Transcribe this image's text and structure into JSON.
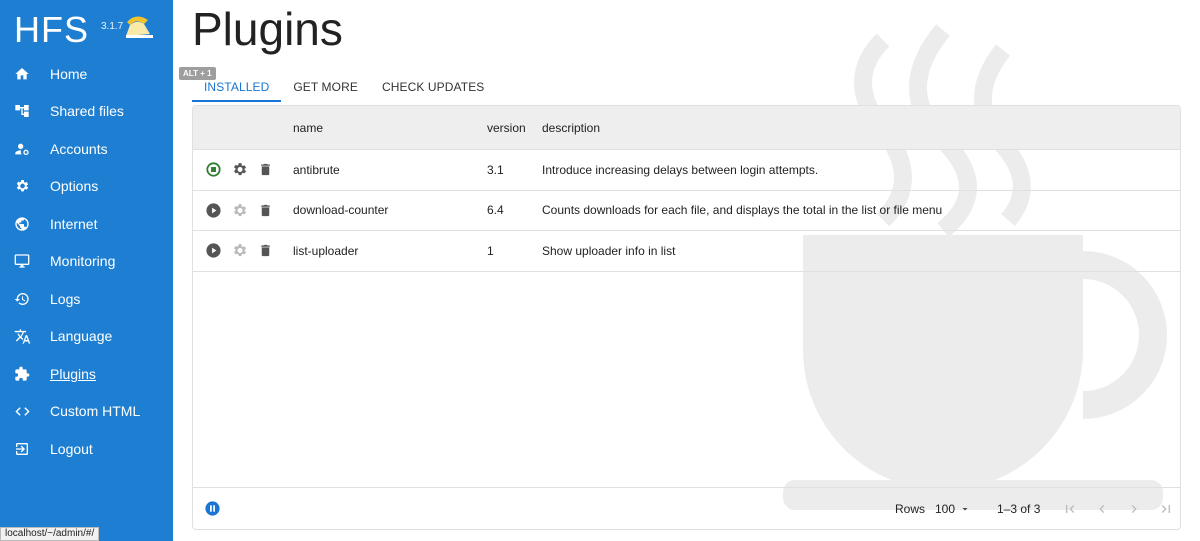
{
  "app": {
    "title": "HFS",
    "version": "3.1.7"
  },
  "sidebar": {
    "items": [
      {
        "label": "Home",
        "icon": "home-icon"
      },
      {
        "label": "Shared files",
        "icon": "account-tree-icon"
      },
      {
        "label": "Accounts",
        "icon": "manage-accounts-icon"
      },
      {
        "label": "Options",
        "icon": "gear-icon"
      },
      {
        "label": "Internet",
        "icon": "globe-icon"
      },
      {
        "label": "Monitoring",
        "icon": "monitor-icon"
      },
      {
        "label": "Logs",
        "icon": "history-icon"
      },
      {
        "label": "Language",
        "icon": "translate-icon"
      },
      {
        "label": "Plugins",
        "icon": "puzzle-icon",
        "active": true
      },
      {
        "label": "Custom HTML",
        "icon": "code-icon"
      },
      {
        "label": "Logout",
        "icon": "logout-icon"
      }
    ]
  },
  "status_url": "localhost/~/admin/#/",
  "page": {
    "title": "Plugins",
    "shortcut_badge": "ALT + 1"
  },
  "tabs": [
    {
      "label": "INSTALLED",
      "active": true
    },
    {
      "label": "GET MORE"
    },
    {
      "label": "CHECK UPDATES"
    }
  ],
  "table": {
    "headers": {
      "name": "name",
      "version": "version",
      "description": "description"
    },
    "rows": [
      {
        "name": "antibrute",
        "version": "3.1",
        "description": "Introduce increasing delays between login attempts.",
        "running": true
      },
      {
        "name": "download-counter",
        "version": "6.4",
        "description": "Counts downloads for each file, and displays the total in the list or file menu",
        "running": false
      },
      {
        "name": "list-uploader",
        "version": "1",
        "description": "Show uploader info in list",
        "running": false
      }
    ]
  },
  "footer": {
    "rows_label": "Rows",
    "rows_per_page": "100",
    "range_text": "1–3 of 3"
  },
  "colors": {
    "sidebar": "#1e7fd2",
    "accent": "#1976d2",
    "running_green": "#2e7d32",
    "icon_gray": "#555555"
  }
}
